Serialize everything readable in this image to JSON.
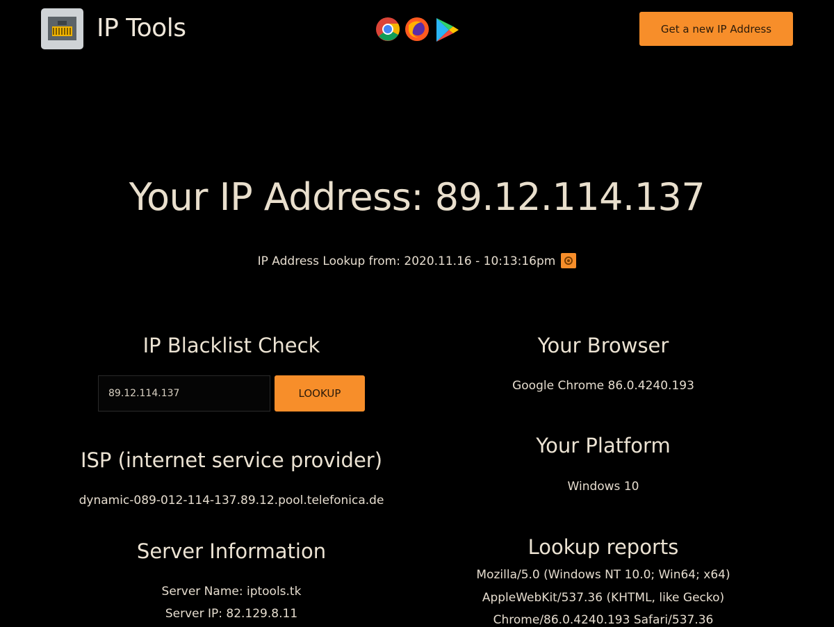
{
  "header": {
    "app_title": "IP Tools",
    "logo_icon": "ethernet-port-icon",
    "store_icons": [
      "chrome-icon",
      "firefox-icon",
      "google-play-icon"
    ],
    "cta_label": "Get a new IP Address"
  },
  "main": {
    "ip_heading": "Your IP Address: 89.12.114.137",
    "lookup_line": "IP Address Lookup from: 2020.11.16 - 10:13:16pm",
    "refresh_icon": "refresh-icon"
  },
  "blacklist": {
    "title": "IP Blacklist Check",
    "input_value": "89.12.114.137",
    "button_label": "LOOKUP"
  },
  "isp": {
    "title": "ISP (internet service provider)",
    "value": "dynamic-089-012-114-137.89.12.pool.telefonica.de"
  },
  "server": {
    "title": "Server Information",
    "name_line": "Server Name: iptools.tk",
    "ip_line": "Server IP: 82.129.8.11"
  },
  "browser": {
    "title": "Your Browser",
    "value": "Google Chrome 86.0.4240.193"
  },
  "platform": {
    "title": "Your Platform",
    "value": "Windows 10"
  },
  "reports": {
    "title": "Lookup reports",
    "lines": [
      "Mozilla/5.0 (Windows NT 10.0; Win64; x64)",
      "AppleWebKit/537.36 (KHTML, like Gecko)",
      "Chrome/86.0.4240.193 Safari/537.36"
    ]
  },
  "colors": {
    "background": "#000000",
    "accent": "#f78e2a",
    "text": "#e8e0d2"
  }
}
